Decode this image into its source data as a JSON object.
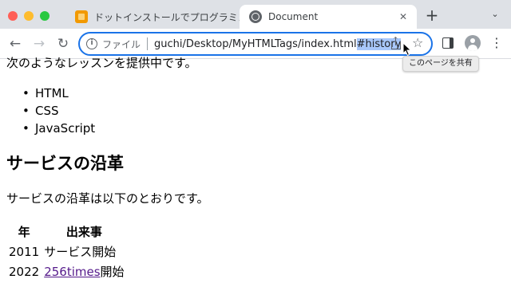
{
  "window_controls": [
    "close",
    "minimize",
    "zoom"
  ],
  "tabs": [
    {
      "title": "ドットインストールでプログラミング",
      "icon": "dotinstall-favicon-icon",
      "active": false
    },
    {
      "title": "Document",
      "icon": "globe-icon",
      "active": true
    }
  ],
  "toolbar": {
    "scheme_label": "ファイル",
    "url_main": "guchi/Desktop/MyHTMLTags/index.html",
    "url_fragment": "#history",
    "share_tooltip": "このページを共有"
  },
  "page": {
    "intro": "次のようなレッスンを提供中です。",
    "lessons": [
      "HTML",
      "CSS",
      "JavaScript"
    ],
    "heading": "サービスの沿革",
    "paragraph": "サービスの沿革は以下のとおりです。",
    "table": {
      "headers": [
        "年",
        "出来事"
      ],
      "rows": [
        {
          "year": "2011",
          "event": "サービス開始",
          "link": "",
          "suffix": ""
        },
        {
          "year": "2022",
          "event": "",
          "link": "256times",
          "suffix": "開始"
        }
      ]
    }
  },
  "colors": {
    "tabstrip": "#dee1e6",
    "omnibox_focus": "#1a73e8",
    "selection": "#a8c7fa",
    "visited_link": "#551a8b"
  }
}
